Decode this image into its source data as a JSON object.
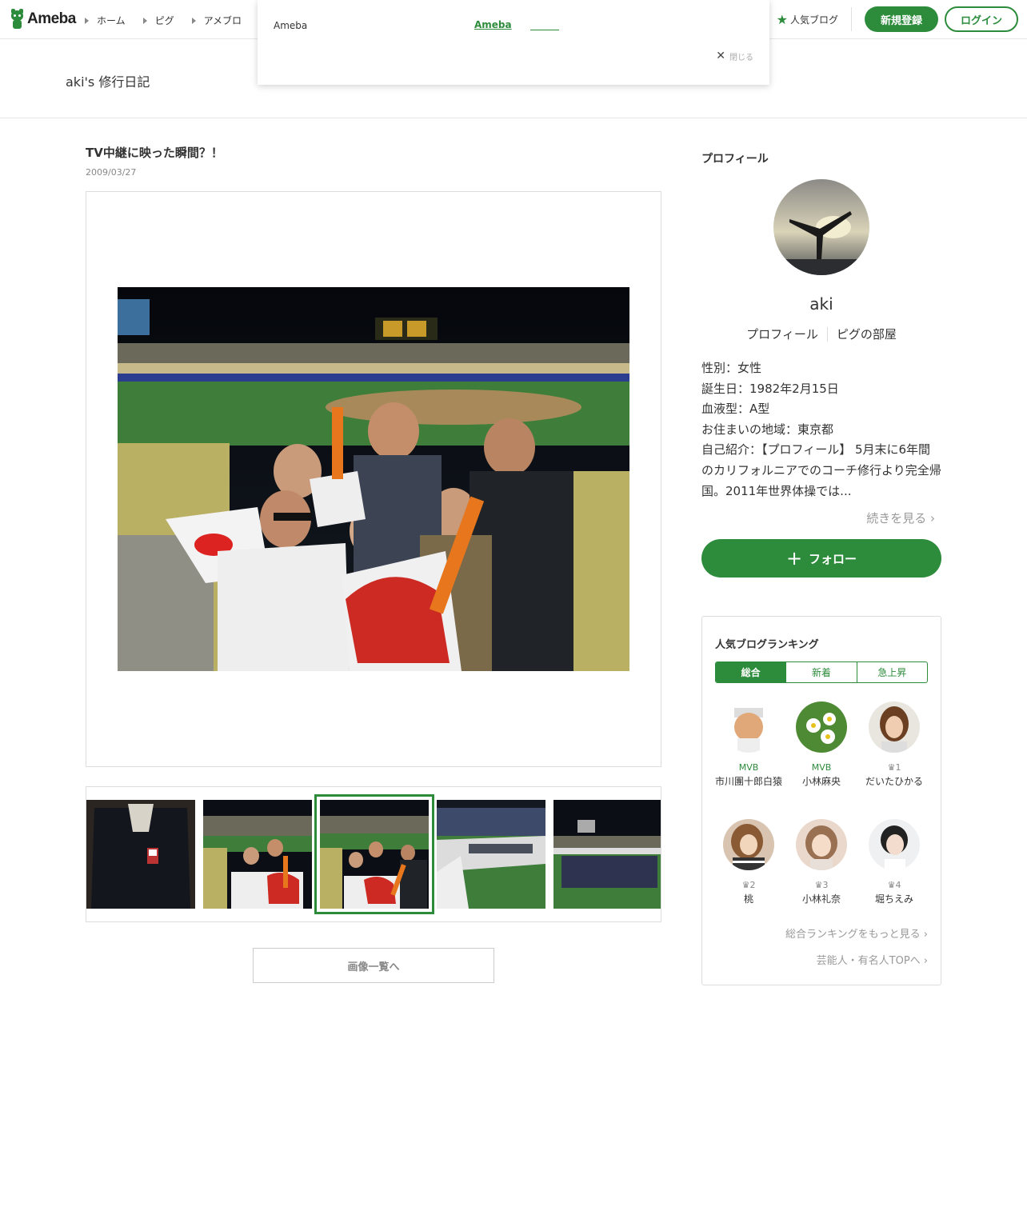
{
  "header": {
    "logo_text": "Ameba",
    "nav": [
      "ホーム",
      "ピグ",
      "アメブロ"
    ],
    "popular_label": "人気ブログ",
    "signup_label": "新規登録",
    "login_label": "ログイン"
  },
  "popup": {
    "text": "Ameba",
    "link": "Ameba",
    "close_label": "閉じる"
  },
  "blog": {
    "title": "aki's 修行日記"
  },
  "entry": {
    "title": "TV中継に映った瞬間？！",
    "date": "2009/03/27",
    "gallery_button": "画像一覧へ"
  },
  "sidebar": {
    "heading": "プロフィール",
    "name": "aki",
    "links": [
      "プロフィール",
      "ピグの部屋"
    ],
    "info": [
      "性別：女性",
      "誕生日：1982年2月15日",
      "血液型：A型",
      "お住まいの地域：東京都",
      "自己紹介：【プロフィール】 5月末に6年間のカリフォルニアでのコーチ修行より完全帰国。2011年世界体操では..."
    ],
    "more_label": "続きを見る",
    "follow_label": "フォロー"
  },
  "ranking": {
    "heading": "人気ブログランキング",
    "tabs": [
      "総合",
      "新着",
      "急上昇"
    ],
    "items": [
      {
        "rank": "MVB",
        "name": "市川團十郎白猿"
      },
      {
        "rank": "MVB",
        "name": "小林麻央"
      },
      {
        "rank": "1",
        "name": "だいたひかる"
      },
      {
        "rank": "2",
        "name": "桃"
      },
      {
        "rank": "3",
        "name": "小林礼奈"
      },
      {
        "rank": "4",
        "name": "堀ちえみ"
      }
    ],
    "more_overall": "総合ランキングをもっと見る",
    "more_celeb": "芸能人・有名人TOPへ"
  },
  "colors": {
    "brand_green": "#2d8c3c"
  }
}
